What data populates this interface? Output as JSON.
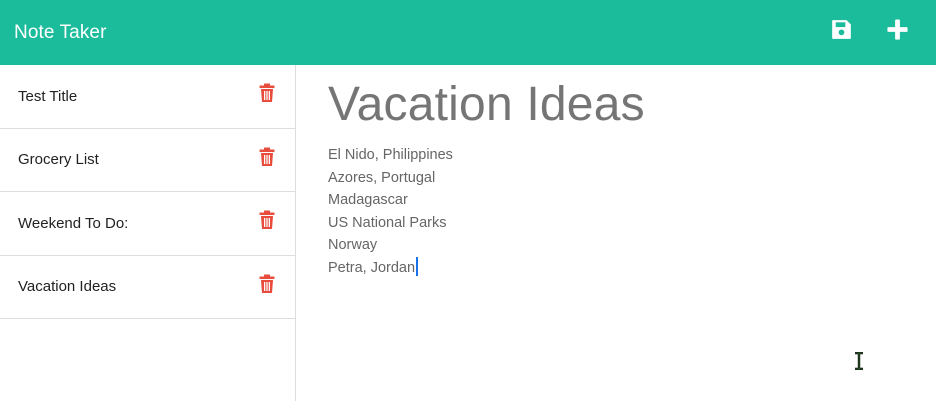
{
  "app": {
    "title": "Note Taker"
  },
  "navbar": {
    "save_icon": "save-icon",
    "new_icon": "plus-icon",
    "brand_color": "#1abc9c"
  },
  "sidebar": {
    "notes": [
      {
        "title": "Test Title"
      },
      {
        "title": "Grocery List"
      },
      {
        "title": "Weekend To Do:"
      },
      {
        "title": "Vacation Ideas"
      }
    ],
    "delete_icon": "trash-icon",
    "delete_color": "#e74c3c"
  },
  "editor": {
    "title": "Vacation Ideas",
    "lines": [
      "El Nido, Philippines",
      "Azores, Portugal",
      "Madagascar",
      "US National Parks",
      "Norway",
      "Petra, Jordan"
    ]
  }
}
